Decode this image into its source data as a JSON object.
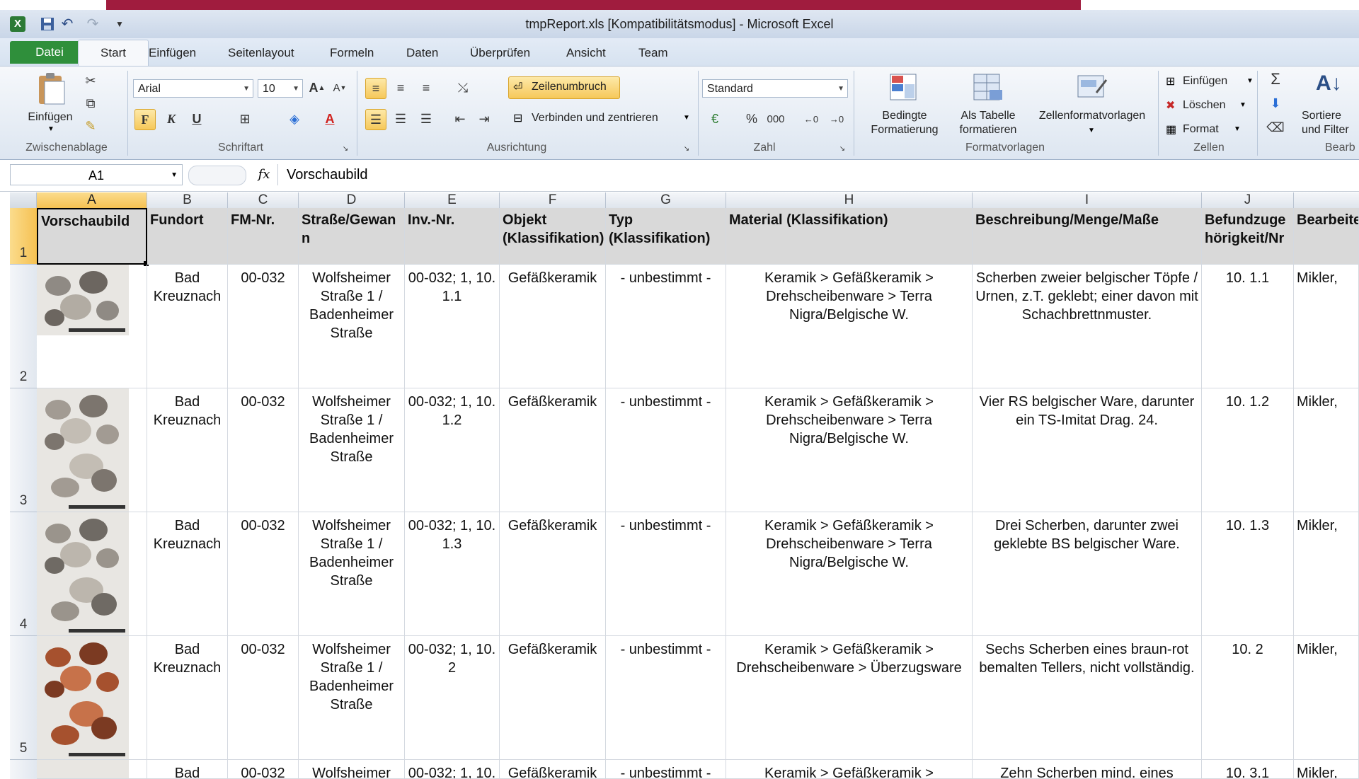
{
  "window": {
    "title": "tmpReport.xls  [Kompatibilitätsmodus]  -  Microsoft Excel"
  },
  "tabs": [
    "Datei",
    "Start",
    "Einfügen",
    "Seitenlayout",
    "Formeln",
    "Daten",
    "Überprüfen",
    "Ansicht",
    "Team"
  ],
  "ribbon": {
    "clipboard": {
      "paste": "Einfügen",
      "group": "Zwischenablage"
    },
    "font": {
      "name": "Arial",
      "size": "10",
      "bold": "F",
      "italic": "K",
      "underline": "U",
      "group": "Schriftart"
    },
    "alignment": {
      "wrap": "Zeilenumbruch",
      "merge": "Verbinden und zentrieren",
      "group": "Ausrichtung"
    },
    "number": {
      "format": "Standard",
      "percent": "%",
      "thousands": "000",
      "group": "Zahl"
    },
    "styles": {
      "conditional_1": "Bedingte",
      "conditional_2": "Formatierung",
      "table_1": "Als Tabelle",
      "table_2": "formatieren",
      "cellstyles": "Zellenformatvorlagen",
      "group": "Formatvorlagen"
    },
    "cells": {
      "insert": "Einfügen",
      "delete": "Löschen",
      "format": "Format",
      "group": "Zellen"
    },
    "editing": {
      "sort_1": "Sortiere",
      "sort_2": "und Filter",
      "group": "Bearb",
      "sigma": "Σ"
    }
  },
  "formula_bar": {
    "name_box": "A1",
    "fx": "fx",
    "value": "Vorschaubild"
  },
  "columns": [
    "A",
    "B",
    "C",
    "D",
    "E",
    "F",
    "G",
    "H",
    "I",
    "J"
  ],
  "header_row": {
    "row_num": "1",
    "cells": [
      "Vorschaubild",
      "Fundort",
      "FM-Nr.",
      "Straße/Gewan n",
      "Inv.-Nr.",
      "Objekt (Klassifikation)",
      "Typ (Klassifikation)",
      "Material (Klassifikation)",
      "Beschreibung/Menge/Maße",
      "Befundzuge hörigkeit/Nr",
      "Bearbeite"
    ]
  },
  "rows": [
    {
      "num": "2",
      "fundort": "Bad Kreuznach",
      "fm": "00-032",
      "strasse": "Wolfsheimer Straße 1 / Badenheimer Straße",
      "inv": "00-032; 1, 10. 1.1",
      "objekt": "Gefäßkeramik",
      "typ": "- unbestimmt -",
      "material": "Keramik > Gefäßkeramik > Drehscheibenware > Terra Nigra/Belgische W.",
      "beschreibung": "Scherben zweier belgischer Töpfe / Urnen, z.T. geklebt; einer davon mit Schachbrettnmuster.",
      "befund": "10. 1.1",
      "bearb": "Mikler,"
    },
    {
      "num": "3",
      "fundort": "Bad Kreuznach",
      "fm": "00-032",
      "strasse": "Wolfsheimer Straße 1 / Badenheimer Straße",
      "inv": "00-032; 1, 10. 1.2",
      "objekt": "Gefäßkeramik",
      "typ": "- unbestimmt -",
      "material": "Keramik > Gefäßkeramik > Drehscheibenware > Terra Nigra/Belgische W.",
      "beschreibung": "Vier RS belgischer Ware, darunter ein TS-Imitat Drag. 24.",
      "befund": "10. 1.2",
      "bearb": "Mikler,"
    },
    {
      "num": "4",
      "fundort": "Bad Kreuznach",
      "fm": "00-032",
      "strasse": "Wolfsheimer Straße 1 / Badenheimer Straße",
      "inv": "00-032; 1, 10. 1.3",
      "objekt": "Gefäßkeramik",
      "typ": "- unbestimmt -",
      "material": "Keramik > Gefäßkeramik > Drehscheibenware > Terra Nigra/Belgische W.",
      "beschreibung": "Drei Scherben, darunter zwei geklebte BS belgischer Ware.",
      "befund": "10. 1.3",
      "bearb": "Mikler,"
    },
    {
      "num": "5",
      "fundort": "Bad Kreuznach",
      "fm": "00-032",
      "strasse": "Wolfsheimer Straße 1 / Badenheimer Straße",
      "inv": "00-032; 1, 10. 2",
      "objekt": "Gefäßkeramik",
      "typ": "- unbestimmt -",
      "material": "Keramik > Gefäßkeramik > Drehscheibenware > Überzugsware",
      "beschreibung": "Sechs Scherben eines braun-rot bemalten Tellers, nicht vollständig.",
      "befund": "10. 2",
      "bearb": "Mikler,"
    },
    {
      "num": "",
      "fundort": "Bad",
      "fm": "00-032",
      "strasse": "Wolfsheimer",
      "inv": "00-032; 1, 10.",
      "objekt": "Gefäßkeramik",
      "typ": "- unbestimmt -",
      "material": "Keramik > Gefäßkeramik >",
      "beschreibung": "Zehn Scherben mind. eines",
      "befund": "10. 3.1",
      "bearb": "Mikler,"
    }
  ]
}
